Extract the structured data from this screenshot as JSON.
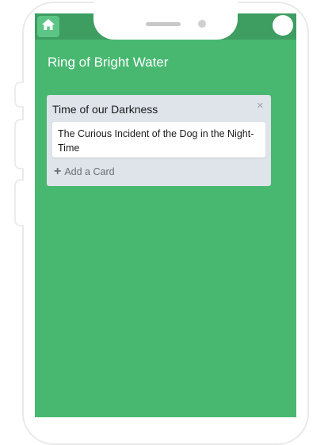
{
  "topbar": {
    "home_icon": "home-icon",
    "profile_icon": "user-avatar"
  },
  "board": {
    "title": "Ring of Bright Water"
  },
  "list": {
    "title": "Time of our Darkness",
    "close_label": "×",
    "cards": [
      {
        "text": "The Curious Incident of the Dog in the Night-Time"
      }
    ],
    "add_card": {
      "icon": "+",
      "label": "Add a Card"
    }
  },
  "colors": {
    "board_background": "#48b871",
    "topbar_background": "#3e9d61",
    "list_background": "#dfe3ea"
  }
}
